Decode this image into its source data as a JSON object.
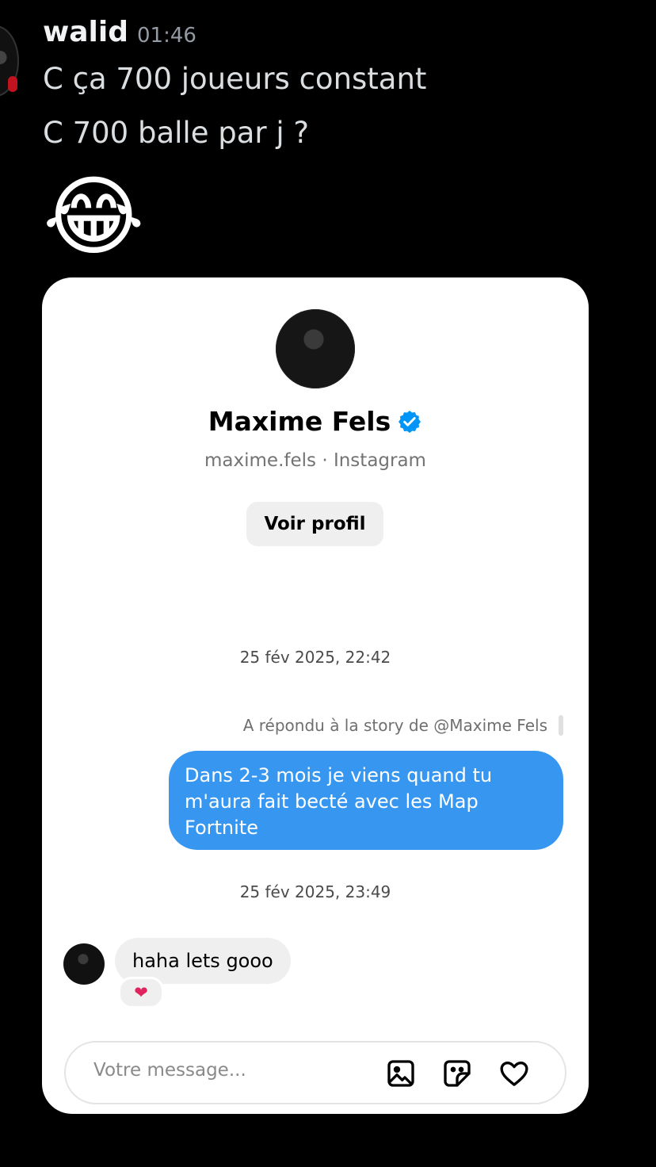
{
  "message": {
    "author": "walid",
    "time": "01:46",
    "lines": [
      "C ça 700 joueurs constant",
      "C 700 balle par j ?"
    ],
    "emoji": "😂"
  },
  "card": {
    "profile_name": "Maxime Fels",
    "profile_handle": "maxime.fels · Instagram",
    "view_profile_label": "Voir profil",
    "date_1": "25 fév 2025, 22:42",
    "replied_story": "A répondu à la story de @Maxime Fels",
    "sent_message": "Dans 2-3 mois je viens quand tu m'aura fait becté avec les Map Fortnite",
    "date_2": "25 fév 2025, 23:49",
    "received_message": "haha lets gooo",
    "reaction": "❤",
    "input_placeholder": "Votre message...",
    "accent_color": "#3797f0"
  }
}
